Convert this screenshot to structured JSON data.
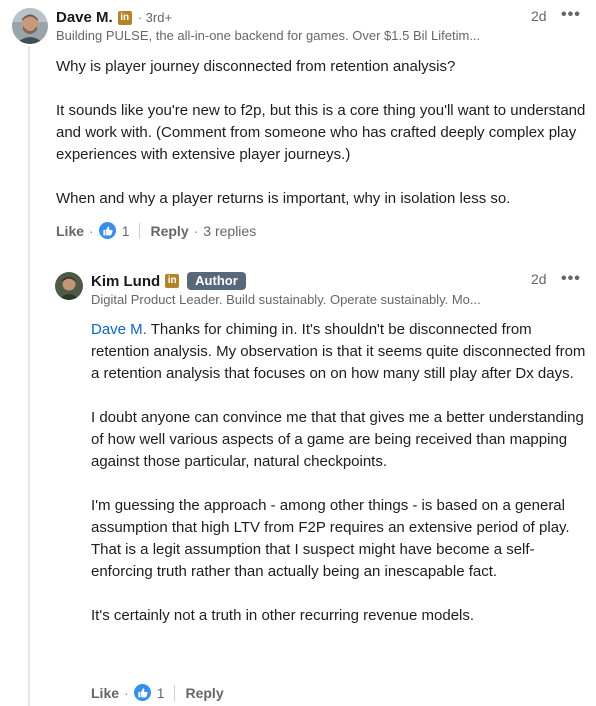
{
  "comment": {
    "author": "Dave M.",
    "degree": "3rd+",
    "headline": "Building PULSE, the all-in-one backend for games. Over $1.5 Bil Lifetim...",
    "time": "2d",
    "paragraphs": [
      "Why is player journey disconnected from retention analysis?",
      "It sounds like you're new to f2p, but this is a core thing you'll want to understand and work with. (Comment from someone who has crafted deeply complex play experiences with extensive player journeys.)",
      "When and why a player returns is important, why in isolation less so."
    ],
    "like_label": "Like",
    "like_count": "1",
    "reply_label": "Reply",
    "replies_label": "3 replies"
  },
  "reply": {
    "author": "Kim Lund",
    "badge": "Author",
    "headline": "Digital Product Leader. Build sustainably. Operate sustainably. Mo...",
    "time": "2d",
    "mention": "Dave M.",
    "first_paragraph_rest": " Thanks for chiming in. It's shouldn't be disconnected from retention analysis. My observation is that it seems quite disconnected from a retention analysis that focuses on on how many still play after Dx days.",
    "paragraphs": [
      "I doubt anyone can convince me that that gives me a better understanding of how well various aspects of a game are being received than mapping against those particular, natural checkpoints.",
      "I'm guessing the approach - among other things - is based on a general assumption that high LTV from F2P requires an extensive period of play. That is a legit assumption that I suspect might have become a self-enforcing truth rather than actually being an inescapable fact.",
      "It's certainly not a truth in other recurring revenue models."
    ],
    "like_label": "Like",
    "like_count": "1",
    "reply_label": "Reply"
  },
  "icons": {
    "linkedin_badge": "in",
    "more": "•••",
    "like": "thumbs-up-icon"
  },
  "colors": {
    "link": "#0a66c2",
    "badge_bg": "#56687a",
    "linkedin_gold": "#b3852b",
    "like_blue": "#378fe9"
  }
}
